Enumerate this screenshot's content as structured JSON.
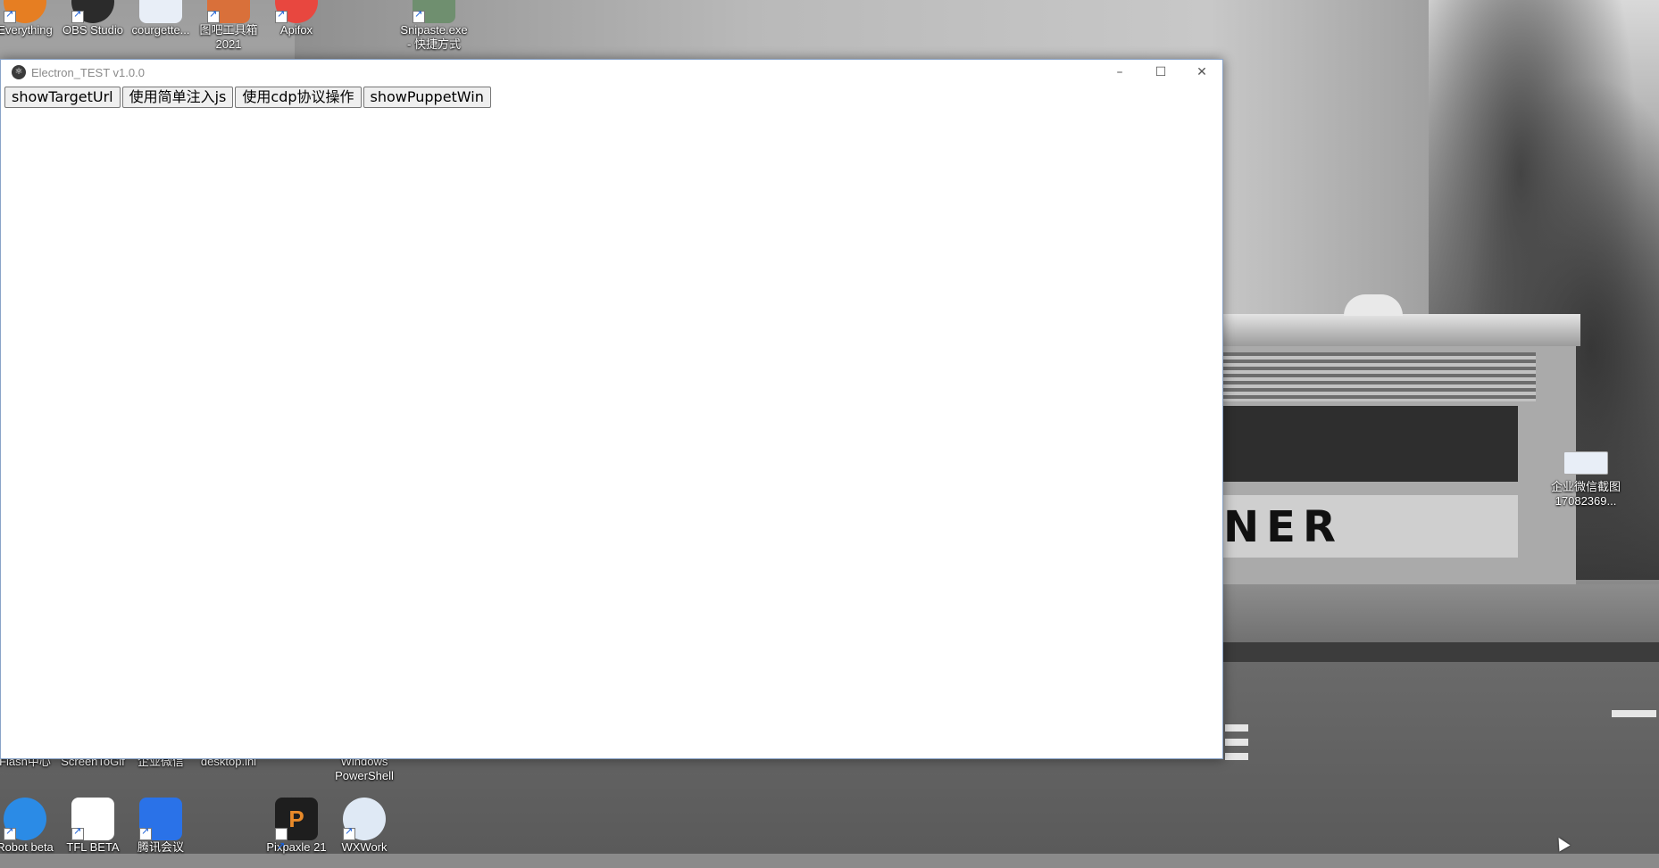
{
  "window": {
    "title": "Electron_TEST v1.0.0",
    "buttons": [
      "showTargetUrl",
      "使用简单注入js",
      "使用cdp协议操作",
      "showPuppetWin"
    ],
    "minimize_symbol": "–",
    "maximize_symbol": "☐",
    "close_symbol": "✕"
  },
  "desktop": {
    "top_icons": [
      {
        "label": "Everything",
        "icon": "everything-icon",
        "color": "#e67e22"
      },
      {
        "label": "OBS Studio",
        "icon": "obs-icon",
        "color": "#2b2b2b"
      },
      {
        "label": "courgette...",
        "icon": "vscode-file-icon",
        "color": "#e8eef7"
      },
      {
        "label": "图吧工具箱\n2021",
        "icon": "toolbox-icon",
        "color": "#d9703a"
      },
      {
        "label": "Apifox",
        "icon": "apifox-icon",
        "color": "#e8473f"
      },
      {
        "label": "Snipaste.exe\n- 快捷方式",
        "icon": "snipaste-icon",
        "color": "#6f8f6f"
      }
    ],
    "middle_row_labels": [
      {
        "label": "Flash中心",
        "icon": "flash-center-icon"
      },
      {
        "label": "ScreenToGif",
        "icon": "screentogif-icon"
      },
      {
        "label": "企业微信",
        "icon": "wecom-icon"
      },
      {
        "label": "desktop.ini",
        "icon": "ini-file-icon"
      },
      {
        "label": "Windows\nPowerShell",
        "icon": "powershell-icon"
      }
    ],
    "bottom_icons": [
      {
        "label": "Robot beta",
        "icon": "robot-icon",
        "color": "#2b8be6"
      },
      {
        "label": "TFL BETA",
        "icon": "tfl-icon",
        "color": "#ffffff"
      },
      {
        "label": "腾讯会议",
        "icon": "tencent-meeting-icon",
        "color": "#2a72e8"
      },
      {
        "label": "Pixpaxle 21",
        "icon": "p21-icon",
        "color": "#1e1e1e"
      },
      {
        "label": "WXWork",
        "icon": "wxwork-icon",
        "color": "#dfe9f5"
      }
    ],
    "right_file": {
      "label": "企业微信截图\n17082369...",
      "icon": "screenshot-file-icon"
    },
    "sign_text": "NER"
  }
}
